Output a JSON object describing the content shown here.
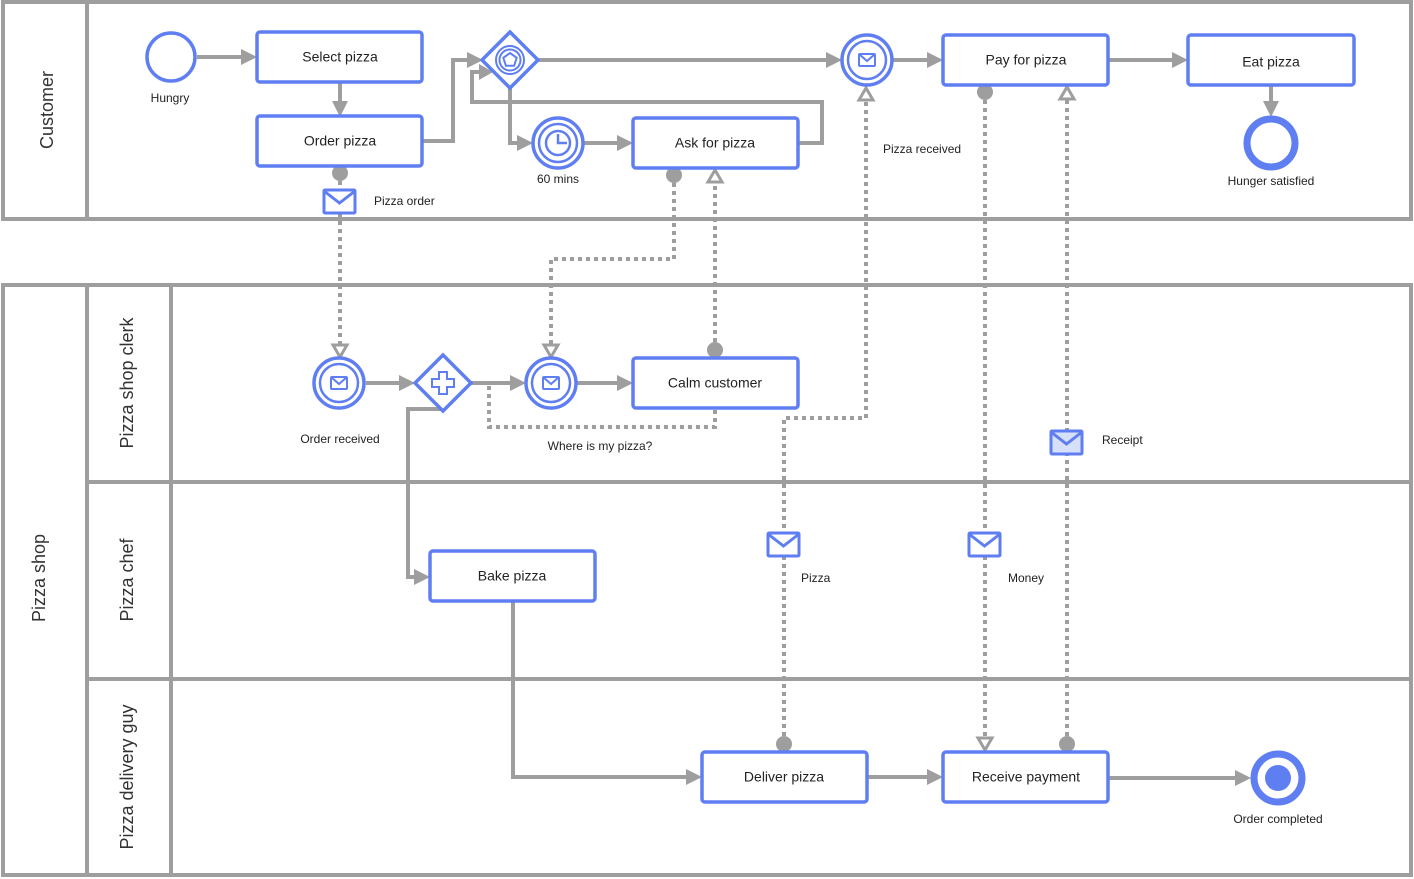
{
  "colors": {
    "accent": "#5f7ef2",
    "line": "#9e9e9e",
    "envelope_fill_light": "#d6e0f8",
    "text": "#222222"
  },
  "pools": {
    "customer": {
      "label": "Customer"
    },
    "pizza_shop": {
      "label": "Pizza shop",
      "lanes": [
        {
          "label": "Pizza shop clerk"
        },
        {
          "label": "Pizza chef"
        },
        {
          "label": "Pizza delivery guy"
        }
      ]
    }
  },
  "tasks": {
    "select_pizza": "Select pizza",
    "order_pizza": "Order pizza",
    "ask_for_pizza": "Ask for pizza",
    "pay_for_pizza": "Pay for pizza",
    "eat_pizza": "Eat pizza",
    "calm_customer": "Calm customer",
    "bake_pizza": "Bake pizza",
    "deliver_pizza": "Deliver pizza",
    "receive_payment": "Receive payment"
  },
  "events": {
    "hungry": "Hungry",
    "sixty_mins": "60 mins",
    "pizza_received": "Pizza received",
    "hunger_satisfied": "Hunger satisfied",
    "order_received": "Order received",
    "where_is_my_pizza": "Where is my pizza?",
    "order_completed": "Order completed"
  },
  "messages": {
    "pizza_order": "Pizza order",
    "pizza": "Pizza",
    "money": "Money",
    "receipt": "Receipt"
  }
}
